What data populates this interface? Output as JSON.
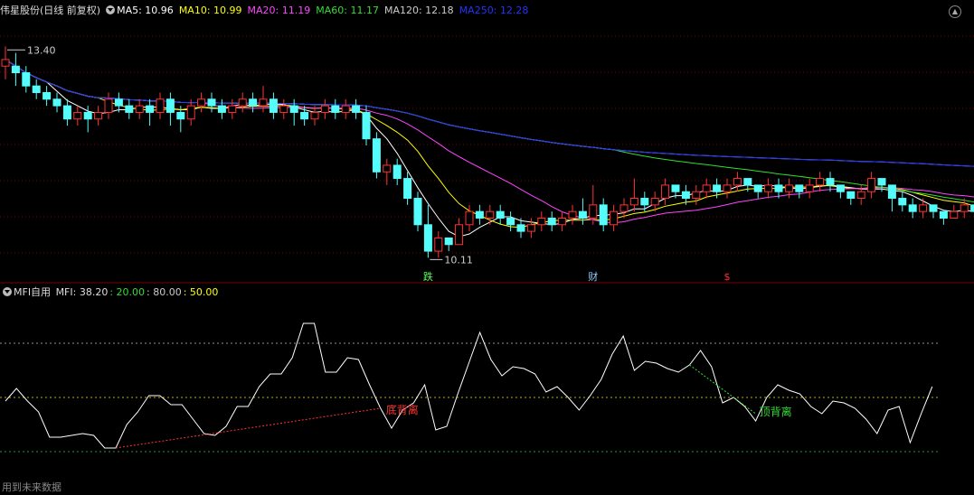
{
  "main_panel": {
    "title": "伟星股份(日线 前复权)",
    "indicators": [
      {
        "label": "MA5: 10.96",
        "color": "#ffffff"
      },
      {
        "label": "MA10: 10.99",
        "color": "#ffff00"
      },
      {
        "label": "MA20: 11.19",
        "color": "#ff44ff"
      },
      {
        "label": "MA60: 11.17",
        "color": "#33dd33"
      },
      {
        "label": "MA120: 12.18",
        "color": "#cccccc"
      },
      {
        "label": "MA250: 12.28",
        "color": "#2233ff"
      }
    ],
    "high_label": "13.40",
    "low_label": "10.11",
    "markers": [
      {
        "text": "跌",
        "color": "#55ff55"
      },
      {
        "text": "财",
        "color": "#88ccff"
      },
      {
        "text": "$",
        "color": "#ff3333"
      }
    ],
    "colors": {
      "up": "#ff3333",
      "down": "#54fcfc",
      "bg": "#000000",
      "grid": "#7a0000"
    }
  },
  "mfi_panel": {
    "title": "MFI自用",
    "values_text": [
      {
        "label": "MFI: 38.20",
        "color": "#dddddd"
      },
      {
        "label": ": 20.00",
        "color": "#33dd33"
      },
      {
        "label": ": 80.00",
        "color": "#cccccc"
      },
      {
        "label": ": 50.00",
        "color": "#ffff00"
      }
    ],
    "bottom_divergence_label": "底背离",
    "top_divergence_label": "顶背离",
    "footer_note": "用到未来数据"
  },
  "chart_data": [
    {
      "type": "candlestick",
      "y_range": [
        9.9,
        13.7
      ],
      "ma_periods": [
        5,
        10,
        20,
        60,
        120,
        250
      ],
      "candles": [
        [
          13.0,
          13.1,
          12.8,
          13.3
        ],
        [
          13.0,
          12.9,
          12.7,
          13.2
        ],
        [
          12.9,
          12.7,
          12.6,
          13.0
        ],
        [
          12.7,
          12.6,
          12.5,
          12.8
        ],
        [
          12.6,
          12.5,
          12.4,
          12.7
        ],
        [
          12.5,
          12.4,
          12.3,
          12.6
        ],
        [
          12.4,
          12.2,
          12.1,
          12.5
        ],
        [
          12.2,
          12.3,
          12.1,
          12.4
        ],
        [
          12.3,
          12.2,
          12.0,
          12.4
        ],
        [
          12.2,
          12.3,
          12.1,
          12.4
        ],
        [
          12.3,
          12.5,
          12.2,
          12.6
        ],
        [
          12.5,
          12.4,
          12.3,
          12.6
        ],
        [
          12.4,
          12.3,
          12.2,
          12.5
        ],
        [
          12.3,
          12.4,
          12.2,
          12.5
        ],
        [
          12.4,
          12.3,
          12.1,
          12.5
        ],
        [
          12.3,
          12.5,
          12.2,
          12.6
        ],
        [
          12.5,
          12.3,
          12.1,
          12.6
        ],
        [
          12.3,
          12.2,
          12.0,
          12.4
        ],
        [
          12.2,
          12.4,
          12.1,
          12.5
        ],
        [
          12.4,
          12.5,
          12.3,
          12.6
        ],
        [
          12.5,
          12.4,
          12.3,
          12.6
        ],
        [
          12.4,
          12.3,
          12.2,
          12.5
        ],
        [
          12.3,
          12.4,
          12.2,
          12.5
        ],
        [
          12.4,
          12.5,
          12.3,
          12.6
        ],
        [
          12.5,
          12.4,
          12.3,
          12.6
        ],
        [
          12.4,
          12.5,
          12.3,
          12.7
        ],
        [
          12.5,
          12.3,
          12.2,
          12.6
        ],
        [
          12.3,
          12.4,
          12.2,
          12.5
        ],
        [
          12.4,
          12.3,
          12.1,
          12.5
        ],
        [
          12.3,
          12.2,
          12.1,
          12.4
        ],
        [
          12.2,
          12.3,
          12.1,
          12.4
        ],
        [
          12.3,
          12.4,
          12.2,
          12.5
        ],
        [
          12.4,
          12.3,
          12.2,
          12.5
        ],
        [
          12.3,
          12.4,
          12.2,
          12.5
        ],
        [
          12.4,
          12.3,
          12.2,
          12.5
        ],
        [
          12.3,
          11.9,
          11.8,
          12.4
        ],
        [
          11.9,
          11.4,
          11.3,
          12.0
        ],
        [
          11.4,
          11.5,
          11.2,
          11.6
        ],
        [
          11.5,
          11.3,
          11.2,
          11.6
        ],
        [
          11.3,
          11.0,
          10.9,
          11.4
        ],
        [
          11.0,
          10.6,
          10.5,
          11.1
        ],
        [
          10.6,
          10.2,
          10.1,
          10.9
        ],
        [
          10.2,
          10.4,
          10.1,
          10.5
        ],
        [
          10.4,
          10.3,
          10.2,
          10.4
        ],
        [
          10.3,
          10.6,
          10.3,
          10.7
        ],
        [
          10.6,
          10.8,
          10.5,
          10.9
        ],
        [
          10.8,
          10.7,
          10.6,
          10.9
        ],
        [
          10.7,
          10.8,
          10.6,
          10.9
        ],
        [
          10.8,
          10.7,
          10.6,
          10.9
        ],
        [
          10.7,
          10.6,
          10.5,
          10.8
        ],
        [
          10.6,
          10.5,
          10.4,
          10.7
        ],
        [
          10.5,
          10.6,
          10.4,
          10.7
        ],
        [
          10.6,
          10.7,
          10.5,
          10.8
        ],
        [
          10.7,
          10.6,
          10.5,
          10.8
        ],
        [
          10.6,
          10.7,
          10.5,
          10.8
        ],
        [
          10.7,
          10.8,
          10.6,
          10.9
        ],
        [
          10.8,
          10.7,
          10.6,
          11.0
        ],
        [
          10.7,
          10.9,
          10.6,
          11.2
        ],
        [
          10.9,
          10.6,
          10.5,
          11.0
        ],
        [
          10.6,
          10.8,
          10.5,
          10.9
        ],
        [
          10.8,
          10.9,
          10.7,
          11.0
        ],
        [
          10.9,
          11.0,
          10.8,
          11.3
        ],
        [
          11.0,
          10.9,
          10.8,
          11.1
        ],
        [
          10.9,
          11.0,
          10.8,
          11.1
        ],
        [
          11.0,
          11.2,
          10.9,
          11.3
        ],
        [
          11.2,
          11.1,
          11.0,
          11.2
        ],
        [
          11.1,
          11.0,
          10.9,
          11.2
        ],
        [
          11.0,
          11.1,
          10.9,
          11.2
        ],
        [
          11.1,
          11.2,
          11.0,
          11.3
        ],
        [
          11.2,
          11.1,
          11.0,
          11.3
        ],
        [
          11.1,
          11.2,
          11.0,
          11.3
        ],
        [
          11.2,
          11.3,
          11.1,
          11.4
        ],
        [
          11.3,
          11.2,
          11.1,
          11.3
        ],
        [
          11.2,
          11.1,
          11.0,
          11.2
        ],
        [
          11.1,
          11.2,
          11.0,
          11.3
        ],
        [
          11.2,
          11.1,
          11.0,
          11.3
        ],
        [
          11.1,
          11.2,
          11.0,
          11.3
        ],
        [
          11.2,
          11.1,
          11.0,
          11.2
        ],
        [
          11.1,
          11.2,
          11.0,
          11.3
        ],
        [
          11.2,
          11.3,
          11.1,
          11.4
        ],
        [
          11.3,
          11.2,
          11.1,
          11.4
        ],
        [
          11.2,
          11.1,
          11.0,
          11.2
        ],
        [
          11.1,
          11.0,
          10.9,
          11.1
        ],
        [
          11.0,
          11.1,
          10.9,
          11.2
        ],
        [
          11.1,
          11.3,
          11.0,
          11.4
        ],
        [
          11.3,
          11.2,
          11.1,
          11.3
        ],
        [
          11.2,
          11.0,
          10.8,
          11.2
        ],
        [
          11.0,
          10.9,
          10.8,
          11.1
        ],
        [
          10.9,
          10.8,
          10.7,
          11.0
        ],
        [
          10.8,
          10.9,
          10.7,
          11.0
        ],
        [
          10.9,
          10.8,
          10.7,
          10.9
        ],
        [
          10.8,
          10.7,
          10.6,
          10.8
        ],
        [
          10.7,
          10.8,
          10.7,
          10.9
        ],
        [
          10.8,
          10.9,
          10.7,
          11.0
        ],
        [
          10.9,
          10.8,
          10.7,
          11.0
        ],
        [
          10.8,
          10.9,
          10.8,
          10.9
        ]
      ]
    },
    {
      "type": "line",
      "name": "MFI",
      "y_range": [
        0,
        100
      ],
      "levels": [
        20,
        50,
        80
      ],
      "values": [
        48,
        55,
        48,
        42,
        28,
        28,
        29,
        30,
        29,
        22,
        22,
        35,
        42,
        51,
        51,
        46,
        46,
        38,
        30,
        29,
        34,
        45,
        45,
        56,
        63,
        63,
        72,
        91,
        91,
        64,
        64,
        72,
        71,
        57,
        44,
        33,
        43,
        47,
        57,
        32,
        34,
        52,
        69,
        86,
        71,
        62,
        67,
        66,
        63,
        53,
        56,
        50,
        43,
        51,
        60,
        74,
        84,
        65,
        70,
        69,
        66,
        64,
        68,
        76,
        67,
        47,
        50,
        45,
        37,
        50,
        57,
        54,
        52,
        45,
        41,
        48,
        47,
        44,
        38,
        30,
        43,
        45,
        25,
        41,
        56
      ]
    }
  ]
}
